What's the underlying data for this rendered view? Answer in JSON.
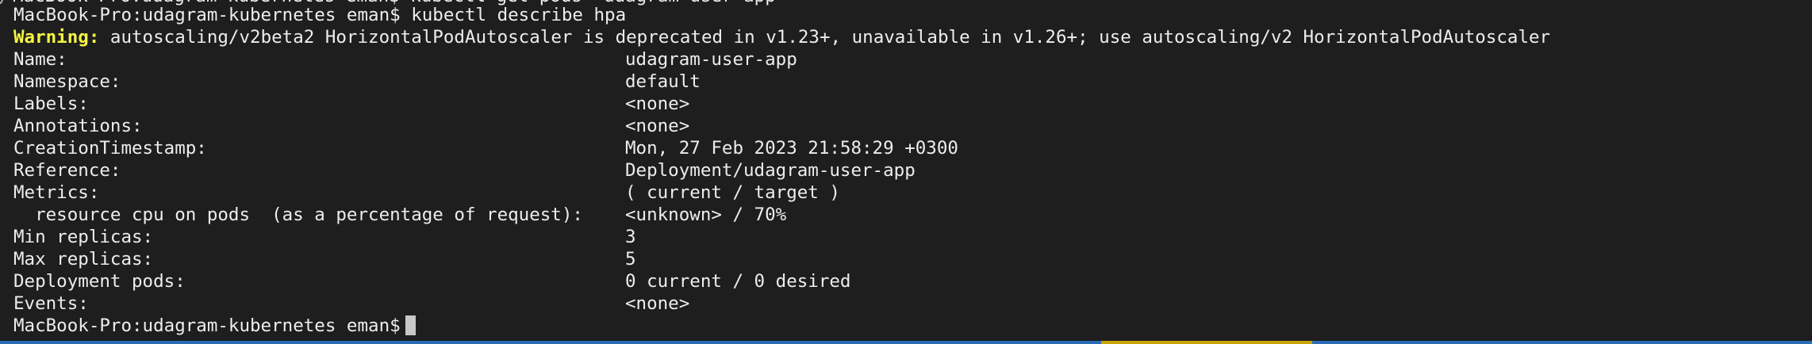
{
  "terminal": {
    "clipped_top_text": "MacBook-Pro:udagram-kubernetes eman$ kubectl get pods  udagram-user-app",
    "prompt": "MacBook-Pro:udagram-kubernetes eman$",
    "command": "kubectl describe hpa",
    "warning_label": "Warning:",
    "warning_text": "autoscaling/v2beta2 HorizontalPodAutoscaler is deprecated in v1.23+, unavailable in v1.26+; use autoscaling/v2 HorizontalPodAutoscaler",
    "fields": [
      {
        "key": "Name:",
        "value": "udagram-user-app"
      },
      {
        "key": "Namespace:",
        "value": "default"
      },
      {
        "key": "Labels:",
        "value": "<none>"
      },
      {
        "key": "Annotations:",
        "value": "<none>"
      },
      {
        "key": "CreationTimestamp:",
        "value": "Mon, 27 Feb 2023 21:58:29 +0300"
      },
      {
        "key": "Reference:",
        "value": "Deployment/udagram-user-app"
      },
      {
        "key": "Metrics:",
        "value": "( current / target )"
      },
      {
        "key": "  resource cpu on pods  (as a percentage of request):",
        "value": "<unknown> / 70%"
      },
      {
        "key": "Min replicas:",
        "value": "3"
      },
      {
        "key": "Max replicas:",
        "value": "5"
      },
      {
        "key": "Deployment pods:",
        "value": "0 current / 0 desired"
      },
      {
        "key": "Events:",
        "value": "<none>"
      }
    ],
    "final_prompt": "MacBook-Pro:udagram-kubernetes eman$"
  },
  "colors": {
    "background": "#1e1e1e",
    "text": "#ededed",
    "warning": "#f5f543",
    "status_bar": "#2a6db5",
    "status_bar_segment": "#c7a400"
  }
}
